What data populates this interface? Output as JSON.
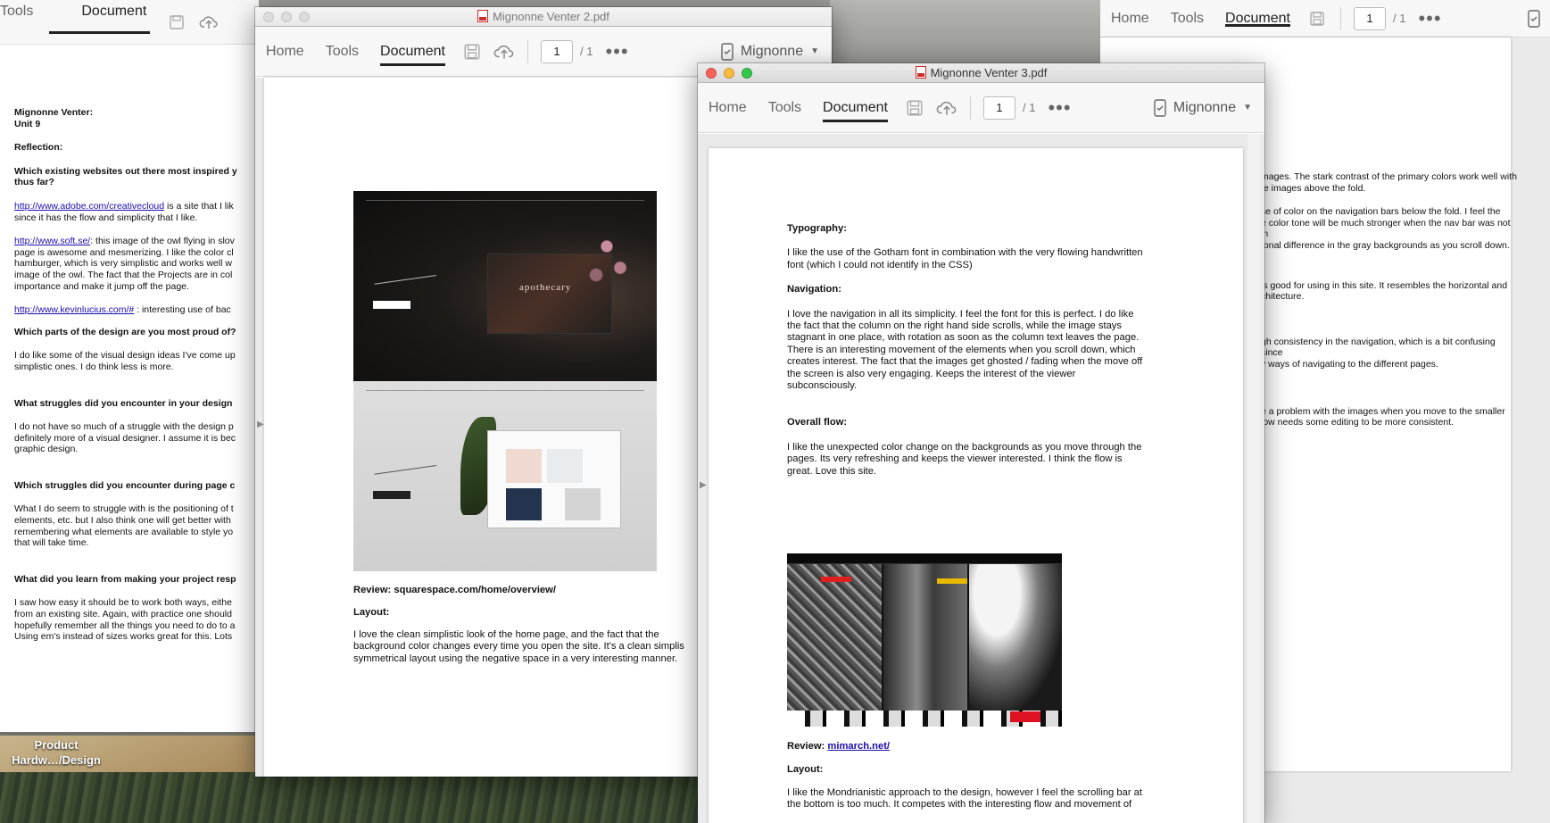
{
  "desktop": {
    "icon_label_line1": "Product",
    "icon_label_line2": "Hardw…/Design"
  },
  "win1": {
    "toolbar": {
      "tools": "Tools",
      "document": "Document"
    },
    "texts": {
      "name": "Mignonne Venter:",
      "unit": "Unit 9",
      "reflection": "Reflection:",
      "q1a": "Which existing websites out there most inspired y",
      "q1b": "thus far?",
      "link1": "http://www.adobe.com/creativecloud",
      "link1_rest": " is a site that I lik",
      "l1b": "since it has the flow and simplicity that I like.",
      "link2": "http://www.soft.se/",
      "link2_rest": ": this image of the owl flying in slov",
      "l2b": "page is awesome and mesmerizing. I like the color cl",
      "l2c": "hamburger, which is very simplistic and works well w",
      "l2d": "image of the owl. The fact that the Projects are in col",
      "l2e": "importance and make it jump off the page.",
      "link3": "http://www.kevinlucius.com/#",
      "link3_rest": " : interesting use of bac",
      "q2": "Which parts of the design are you most proud of?",
      "a2a": "I do like some of the visual design ideas I've come up",
      "a2b": "simplistic ones. I do think less is more.",
      "q3": "What struggles did you encounter in your design",
      "a3a": "I do not have so much of a struggle with the design p",
      "a3b": "definitely more of a visual designer. I assume it is bec",
      "a3c": "graphic design.",
      "q4": "Which struggles did you encounter during page c",
      "a4a": "What I do seem to struggle with is the positioning of t",
      "a4b": "elements, etc. but I also think one will get better with",
      "a4c": "remembering what elements are available to style yo",
      "a4d": "that will take time.",
      "q5": "What did you learn from making your project resp",
      "a5a": "I saw how easy it should be to work both ways, eithe",
      "a5b": "from an existing site. Again, with practice one should",
      "a5c": "hopefully remember all the things you need to do to a",
      "a5d": "Using em's instead of sizes works great for this. Lots"
    }
  },
  "win2": {
    "title": "Mignonne Venter 2.pdf",
    "toolbar": {
      "home": "Home",
      "tools": "Tools",
      "document": "Document",
      "page": "1",
      "total": "/ 1",
      "user": "Mignonne"
    },
    "review": "Review:  squarespace.com/home/overview/",
    "layout_heading": "Layout:",
    "layout_l1": "I love the clean simplistic look of the home page, and the fact that the",
    "layout_l2": "background color changes every time you open the site. It's a clean simplis",
    "layout_l3": "symmetrical layout using the negative space in a very interesting manner.",
    "shot_word": "apothecary"
  },
  "win3": {
    "title": "Mignonne Venter 3.pdf",
    "toolbar": {
      "home": "Home",
      "tools": "Tools",
      "document": "Document",
      "page": "1",
      "total": "/ 1",
      "user": "Mignonne"
    },
    "typography_heading": "Typography:",
    "typo_l1": "I like the use of the Gotham font in combination with the very flowing handwritten",
    "typo_l2": "font (which I could not identify in the CSS)",
    "nav_heading": "Navigation:",
    "nav_l1": "I love the navigation in all its simplicity. I feel the font for this is perfect. I do like",
    "nav_l2": "the fact that the column on the right hand side scrolls, while the image stays",
    "nav_l3": "stagnant in one place, with rotation as soon as the column text leaves the page.",
    "nav_l4": "There is an interesting movement of the elements when you scroll down, which",
    "nav_l5": "creates interest. The fact that the images get ghosted / fading when the move off",
    "nav_l6": "the screen is also very engaging. Keeps the interest of the viewer",
    "nav_l7": "subconsciously.",
    "flow_heading": "Overall flow:",
    "flow_l1": "I like the unexpected color change on the backgrounds as you move through the",
    "flow_l2": "pages. Its very refreshing and keeps the viewer interested. I think the flow is",
    "flow_l3": "great. Love this site.",
    "review_label": "Review: ",
    "review_link": "mimarch.net/",
    "layout_heading": "Layout:",
    "layout_l1": "I like the Mondrianistic approach to the design, however I feel the scrolling bar at",
    "layout_l2": "the bottom is too much. It competes with the interesting flow and movement of"
  },
  "win4": {
    "toolbar": {
      "home": "Home",
      "tools": "Tools",
      "document": "Document",
      "page": "1",
      "total": "/ 1"
    },
    "r1": "mages. The stark contrast of the primary colors work well with",
    "r2": "te images above the fold.",
    "r3": "se of color on the navigation bars below the fold. I feel the",
    "r4": "e color tone will be much stronger when the nav bar was not in",
    "r5": " tonal difference in the gray backgrounds as you scroll down.",
    "r6": " is good for using in this site. It resembles the horizontal and",
    "r7": "chitecture.",
    "r8": "gh consistency in the navigation, which is a bit confusing since",
    "r9": "y ways of navigating to the different pages.",
    "r10": "e a problem with the images when you move to the smaller",
    "r11": "low needs some editing to be more consistent."
  }
}
